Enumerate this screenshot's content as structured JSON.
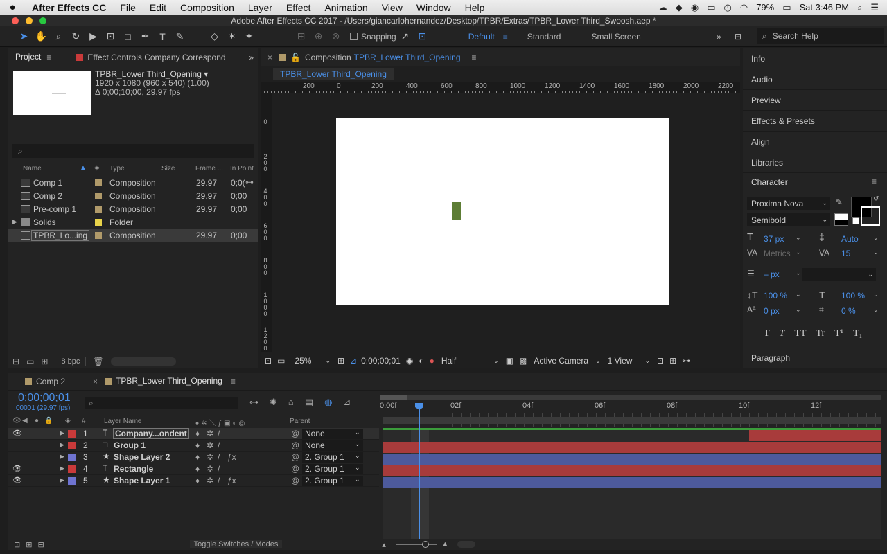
{
  "menubar": {
    "app": "After Effects CC",
    "items": [
      "File",
      "Edit",
      "Composition",
      "Layer",
      "Effect",
      "Animation",
      "View",
      "Window",
      "Help"
    ],
    "battery": "79%",
    "clock": "Sat 3:46 PM"
  },
  "window_title": "Adobe After Effects CC 2017 - /Users/giancarlohernandez/Desktop/TPBR/Extras/TPBR_Lower Third_Swoosh.aep *",
  "toolbar": {
    "snapping": "Snapping",
    "workspaces": [
      "Default",
      "Standard",
      "Small Screen"
    ],
    "active_workspace": "Default",
    "search_placeholder": "Search Help"
  },
  "project": {
    "tab": "Project",
    "effect_controls_tab": "Effect Controls Company Correspond",
    "selected_name": "TPBR_Lower Third_Opening ▾",
    "meta1": "1920 x 1080  (960 x 540) (1.00)",
    "meta2": "Δ 0;00;10;00, 29.97 fps",
    "columns": {
      "name": "Name",
      "type": "Type",
      "size": "Size",
      "frame": "Frame ...",
      "in": "In Point"
    },
    "rows": [
      {
        "name": "Comp 1",
        "type": "Composition",
        "frame": "29.97",
        "in": "0;0(",
        "label": "#b09a6a",
        "folder": false
      },
      {
        "name": "Comp 2",
        "type": "Composition",
        "frame": "29.97",
        "in": "0;00",
        "label": "#b09a6a",
        "folder": false
      },
      {
        "name": "Pre-comp 1",
        "type": "Composition",
        "frame": "29.97",
        "in": "0;00",
        "label": "#b09a6a",
        "folder": false
      },
      {
        "name": "Solids",
        "type": "Folder",
        "frame": "",
        "in": "",
        "label": "#e8d34a",
        "folder": true
      },
      {
        "name": "TPBR_Lo...ing",
        "type": "Composition",
        "frame": "29.97",
        "in": "0;00",
        "label": "#b09a6a",
        "folder": false
      }
    ],
    "bpc": "8 bpc"
  },
  "comp": {
    "tab_prefix": "Composition",
    "tab_name": "TPBR_Lower Third_Opening",
    "subtab": "TPBR_Lower Third_Opening",
    "ruler": [
      "200",
      "0",
      "200",
      "400",
      "600",
      "800",
      "1000",
      "1200",
      "1400",
      "1600",
      "1800",
      "2000",
      "2200"
    ],
    "vruler": [
      "0",
      "2 0 0",
      "4 0 0",
      "6 0 0",
      "8 0 0",
      "1 0 0 0",
      "1 2 0 0"
    ],
    "zoom": "25%",
    "timecode": "0;00;00;01",
    "resolution": "Half",
    "camera": "Active Camera",
    "view": "1 View",
    "colors": {
      "canvas": "#ffffff",
      "shape": "#5d7d35"
    }
  },
  "right": {
    "panels": [
      "Info",
      "Audio",
      "Preview",
      "Effects & Presets",
      "Align",
      "Libraries"
    ],
    "character": "Character",
    "font": "Proxima Nova",
    "style": "Semibold",
    "font_size": "37 px",
    "leading": "Auto",
    "kerning": "Metrics",
    "tracking": "15",
    "stroke": "– px",
    "vscale": "100 %",
    "hscale": "100 %",
    "baseline": "0 px",
    "tsume": "0 %",
    "type_styles": [
      "T",
      "T",
      "TT",
      "Tr",
      "T¹",
      "T₁"
    ],
    "paragraph": "Paragraph"
  },
  "timeline": {
    "tabs": [
      "Comp 2",
      "TPBR_Lower Third_Opening"
    ],
    "timecode": "0;00;00;01",
    "fps": "00001 (29.97 fps)",
    "col_layer": "Layer Name",
    "col_parent": "Parent",
    "col_hash": "#",
    "time_marks": [
      "0:00f",
      "02f",
      "04f",
      "06f",
      "08f",
      "10f",
      "12f"
    ],
    "layers": [
      {
        "num": "1",
        "kind": "T",
        "name": "Company...ondent",
        "parent": "None",
        "label": "#c93a3a",
        "eye": true,
        "fx": false,
        "bar": "#a83b3b",
        "bar_start": 0.735
      },
      {
        "num": "2",
        "kind": "□",
        "name": "Group 1",
        "parent": "None",
        "label": "#c93a3a",
        "eye": false,
        "fx": false,
        "bar": "#a83b3b",
        "bar_start": 0
      },
      {
        "num": "3",
        "kind": "★",
        "name": "Shape Layer 2",
        "parent": "2. Group 1",
        "label": "#6f74d1",
        "eye": false,
        "fx": true,
        "bar": "#4d5a9c",
        "bar_start": 0
      },
      {
        "num": "4",
        "kind": "T",
        "name": "Rectangle",
        "parent": "2. Group 1",
        "label": "#c93a3a",
        "eye": true,
        "fx": false,
        "bar": "#a83b3b",
        "bar_start": 0
      },
      {
        "num": "5",
        "kind": "★",
        "name": "Shape Layer 1",
        "parent": "2. Group 1",
        "label": "#6f74d1",
        "eye": true,
        "fx": true,
        "bar": "#4d5a9c",
        "bar_start": 0
      }
    ],
    "toggle": "Toggle Switches / Modes"
  }
}
